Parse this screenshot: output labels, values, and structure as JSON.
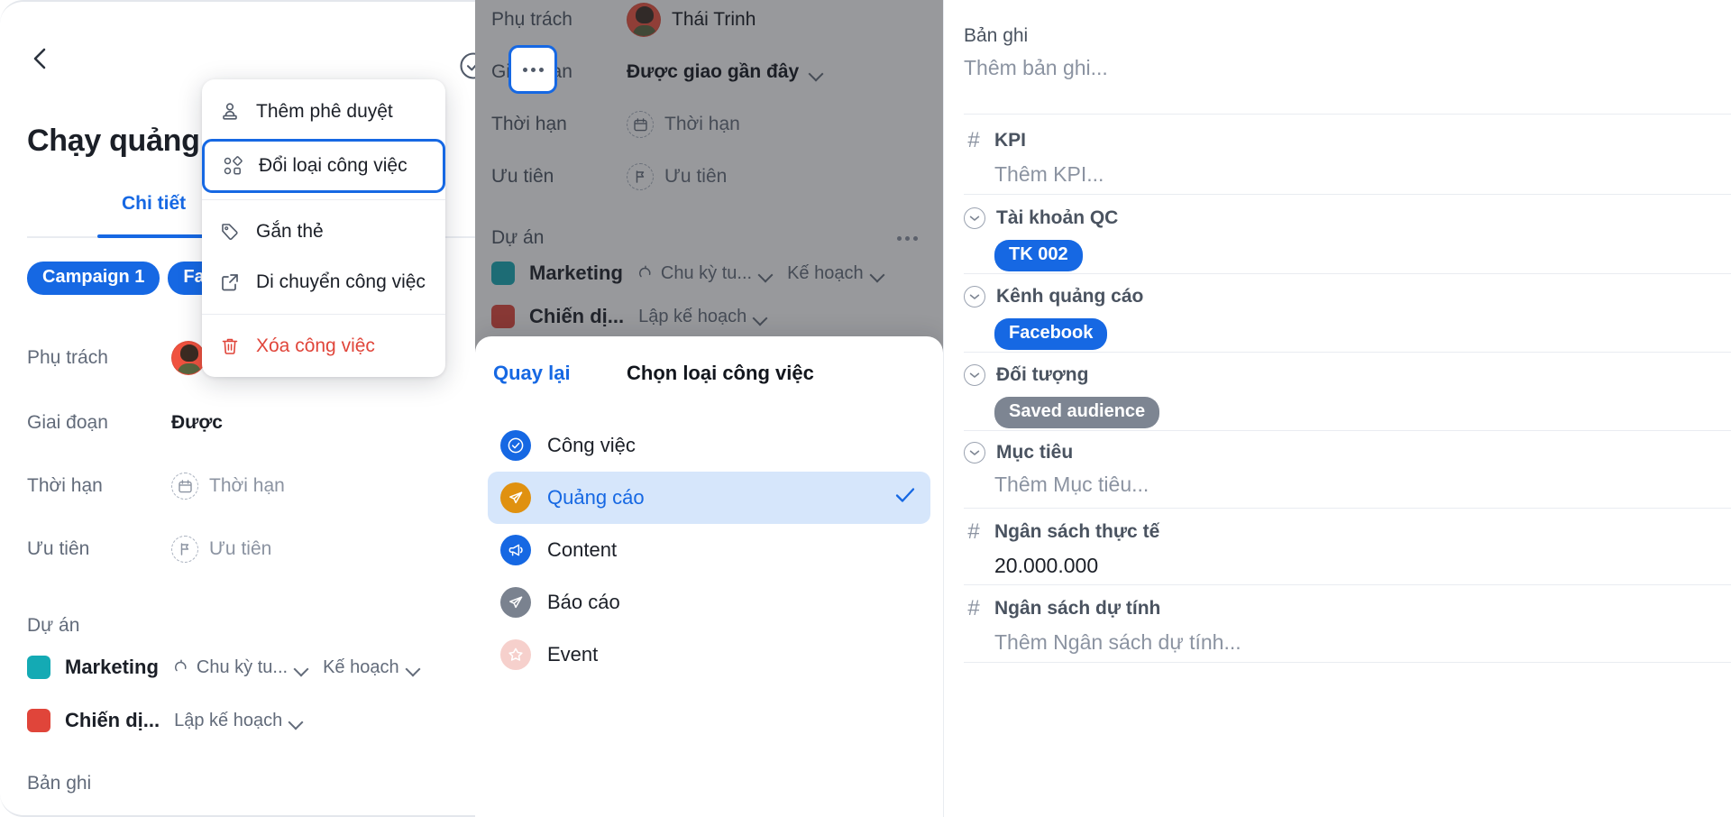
{
  "left_panel": {
    "title": "Chạy quảng cáo",
    "tab_detail": "Chi tiết",
    "chips": [
      "Campaign 1",
      "Facebook"
    ],
    "fields": [
      {
        "label": "Phụ trách",
        "value": "T",
        "kind": "avatar"
      },
      {
        "label": "Giai đoạn",
        "value": "Được",
        "kind": "text"
      },
      {
        "label": "Thời hạn",
        "value": "Thời hạn",
        "kind": "placeholder",
        "icon": "calendar-icon"
      },
      {
        "label": "Ưu tiên",
        "value": "Ưu tiên",
        "kind": "placeholder",
        "icon": "flag-icon"
      }
    ],
    "project_section_label": "Dự án",
    "projects": [
      {
        "name": "Marketing",
        "color": "#14aab4",
        "meta1": "Chu kỳ tu...",
        "meta2": "Kế hoạch",
        "has_cycle_icon": true
      },
      {
        "name": "Chiến dị...",
        "color": "#e0453a",
        "meta1": "Lập kế hoạch",
        "meta2": "",
        "has_cycle_icon": false
      }
    ],
    "record_label": "Bản ghi"
  },
  "context_menu": {
    "items": [
      {
        "label": "Thêm phê duyệt",
        "icon": "stamp-icon",
        "highlighted": false,
        "danger": false
      },
      {
        "label": "Đổi loại công việc",
        "icon": "grid-shapes-icon",
        "highlighted": true,
        "danger": false
      },
      {
        "label": "Gắn thẻ",
        "icon": "tag-icon",
        "highlighted": false,
        "danger": false
      },
      {
        "label": "Di chuyển công việc",
        "icon": "external-link-icon",
        "highlighted": false,
        "danger": false
      },
      {
        "label": "Xóa công việc",
        "icon": "trash-icon",
        "highlighted": false,
        "danger": true
      }
    ]
  },
  "middle_panel": {
    "fields": [
      {
        "label": "Phụ trách",
        "value": "Thái Trinh",
        "kind": "avatar"
      },
      {
        "label": "Giai đoạn",
        "value": "Được giao gần đây",
        "kind": "dropdown"
      },
      {
        "label": "Thời hạn",
        "value": "Thời hạn",
        "kind": "placeholder",
        "icon": "calendar-icon"
      },
      {
        "label": "Ưu tiên",
        "value": "Ưu tiên",
        "kind": "placeholder",
        "icon": "flag-icon"
      }
    ],
    "project_section_label": "Dự án",
    "projects": [
      {
        "name": "Marketing",
        "color": "#14aab4",
        "meta1": "Chu kỳ tu...",
        "meta2": "Kế hoạch",
        "has_cycle_icon": true
      },
      {
        "name": "Chiến dị...",
        "color": "#e0453a",
        "meta1": "Lập kế hoạch",
        "meta2": "",
        "has_cycle_icon": false
      }
    ],
    "sheet": {
      "back_label": "Quay lại",
      "title": "Chọn loại công việc",
      "options": [
        {
          "label": "Công việc",
          "icon": "check-circle-icon",
          "color": "#1668e3",
          "selected": false
        },
        {
          "label": "Quảng cáo",
          "icon": "paper-plane-icon",
          "color": "#e09110",
          "selected": true
        },
        {
          "label": "Content",
          "icon": "megaphone-icon",
          "color": "#1668e3",
          "selected": false
        },
        {
          "label": "Báo cáo",
          "icon": "paper-plane-icon",
          "color": "#7a828f",
          "selected": false
        },
        {
          "label": "Event",
          "icon": "star-icon",
          "color": "#f6d0cc",
          "selected": false
        }
      ]
    }
  },
  "right_panel": {
    "blocks": [
      {
        "label": "Bản ghi",
        "icon": "none",
        "placeholder": "Thêm bản ghi...",
        "value": "",
        "tag": "",
        "tag_color": ""
      },
      {
        "label": "KPI",
        "icon": "hash-icon",
        "placeholder": "Thêm KPI...",
        "value": "",
        "tag": "",
        "tag_color": ""
      },
      {
        "label": "Tài khoản QC",
        "icon": "circle-chevron-icon",
        "placeholder": "",
        "value": "",
        "tag": "TK 002",
        "tag_color": "#1668e3"
      },
      {
        "label": "Kênh quảng cáo",
        "icon": "circle-chevron-icon",
        "placeholder": "",
        "value": "",
        "tag": "Facebook",
        "tag_color": "#1668e3"
      },
      {
        "label": "Đối tượng",
        "icon": "circle-chevron-icon",
        "placeholder": "",
        "value": "",
        "tag": "Saved audience",
        "tag_color": "#7d8592"
      },
      {
        "label": "Mục tiêu",
        "icon": "circle-chevron-icon",
        "placeholder": "Thêm Mục tiêu...",
        "value": "",
        "tag": "",
        "tag_color": ""
      },
      {
        "label": "Ngân sách thực tế",
        "icon": "hash-icon",
        "placeholder": "",
        "value": "20.000.000",
        "tag": "",
        "tag_color": ""
      },
      {
        "label": "Ngân sách dự tính",
        "icon": "hash-icon",
        "placeholder": "Thêm Ngân sách dự tính...",
        "value": "",
        "tag": "",
        "tag_color": ""
      }
    ]
  },
  "colors": {
    "accent": "#1668e3",
    "danger": "#e0453a",
    "muted": "#8b93a1",
    "dim_overlay": "rgba(40,42,48,0.48)"
  }
}
